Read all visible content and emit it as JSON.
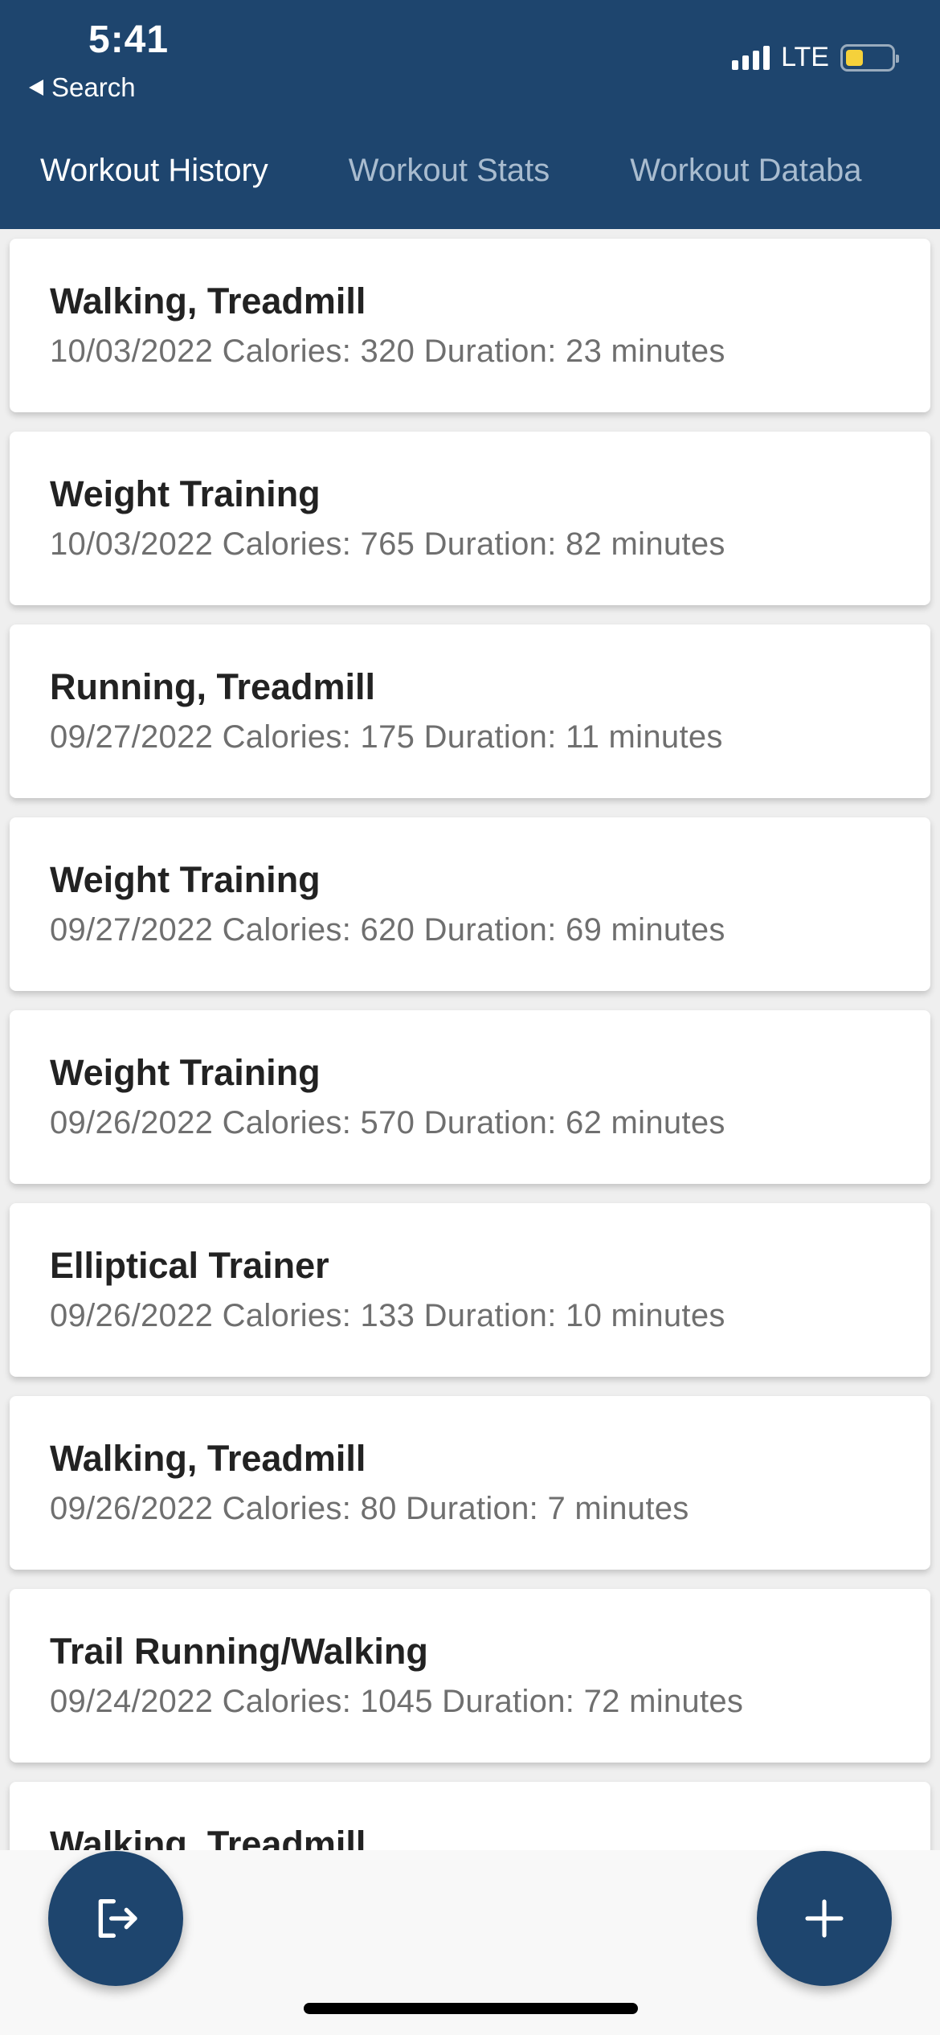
{
  "status_bar": {
    "time": "5:41",
    "back_label": "Search",
    "network": "LTE",
    "battery_level": 0.38,
    "battery_color": "#f5d13b"
  },
  "tabs": [
    {
      "label": "Workout History",
      "active": true
    },
    {
      "label": "Workout Stats",
      "active": false
    },
    {
      "label": "Workout Databa",
      "active": false
    }
  ],
  "workouts": [
    {
      "title": "Walking, Treadmill",
      "details": "10/03/2022 Calories: 320 Duration: 23 minutes"
    },
    {
      "title": "Weight Training",
      "details": "10/03/2022 Calories: 765 Duration: 82 minutes"
    },
    {
      "title": "Running, Treadmill",
      "details": "09/27/2022 Calories: 175 Duration: 11 minutes"
    },
    {
      "title": "Weight Training",
      "details": "09/27/2022 Calories: 620 Duration: 69 minutes"
    },
    {
      "title": "Weight Training",
      "details": "09/26/2022 Calories: 570 Duration: 62 minutes"
    },
    {
      "title": "Elliptical Trainer",
      "details": "09/26/2022 Calories: 133 Duration: 10 minutes"
    },
    {
      "title": "Walking, Treadmill",
      "details": "09/26/2022 Calories: 80 Duration: 7 minutes"
    },
    {
      "title": "Trail Running/Walking",
      "details": "09/24/2022 Calories: 1045 Duration: 72 minutes"
    },
    {
      "title": "Walking, Treadmill",
      "details": ""
    }
  ],
  "actions": {
    "logout_icon": "logout-icon",
    "add_icon": "plus-icon"
  },
  "colors": {
    "primary": "#1e456e",
    "tab_indicator": "#5fa8f0"
  }
}
